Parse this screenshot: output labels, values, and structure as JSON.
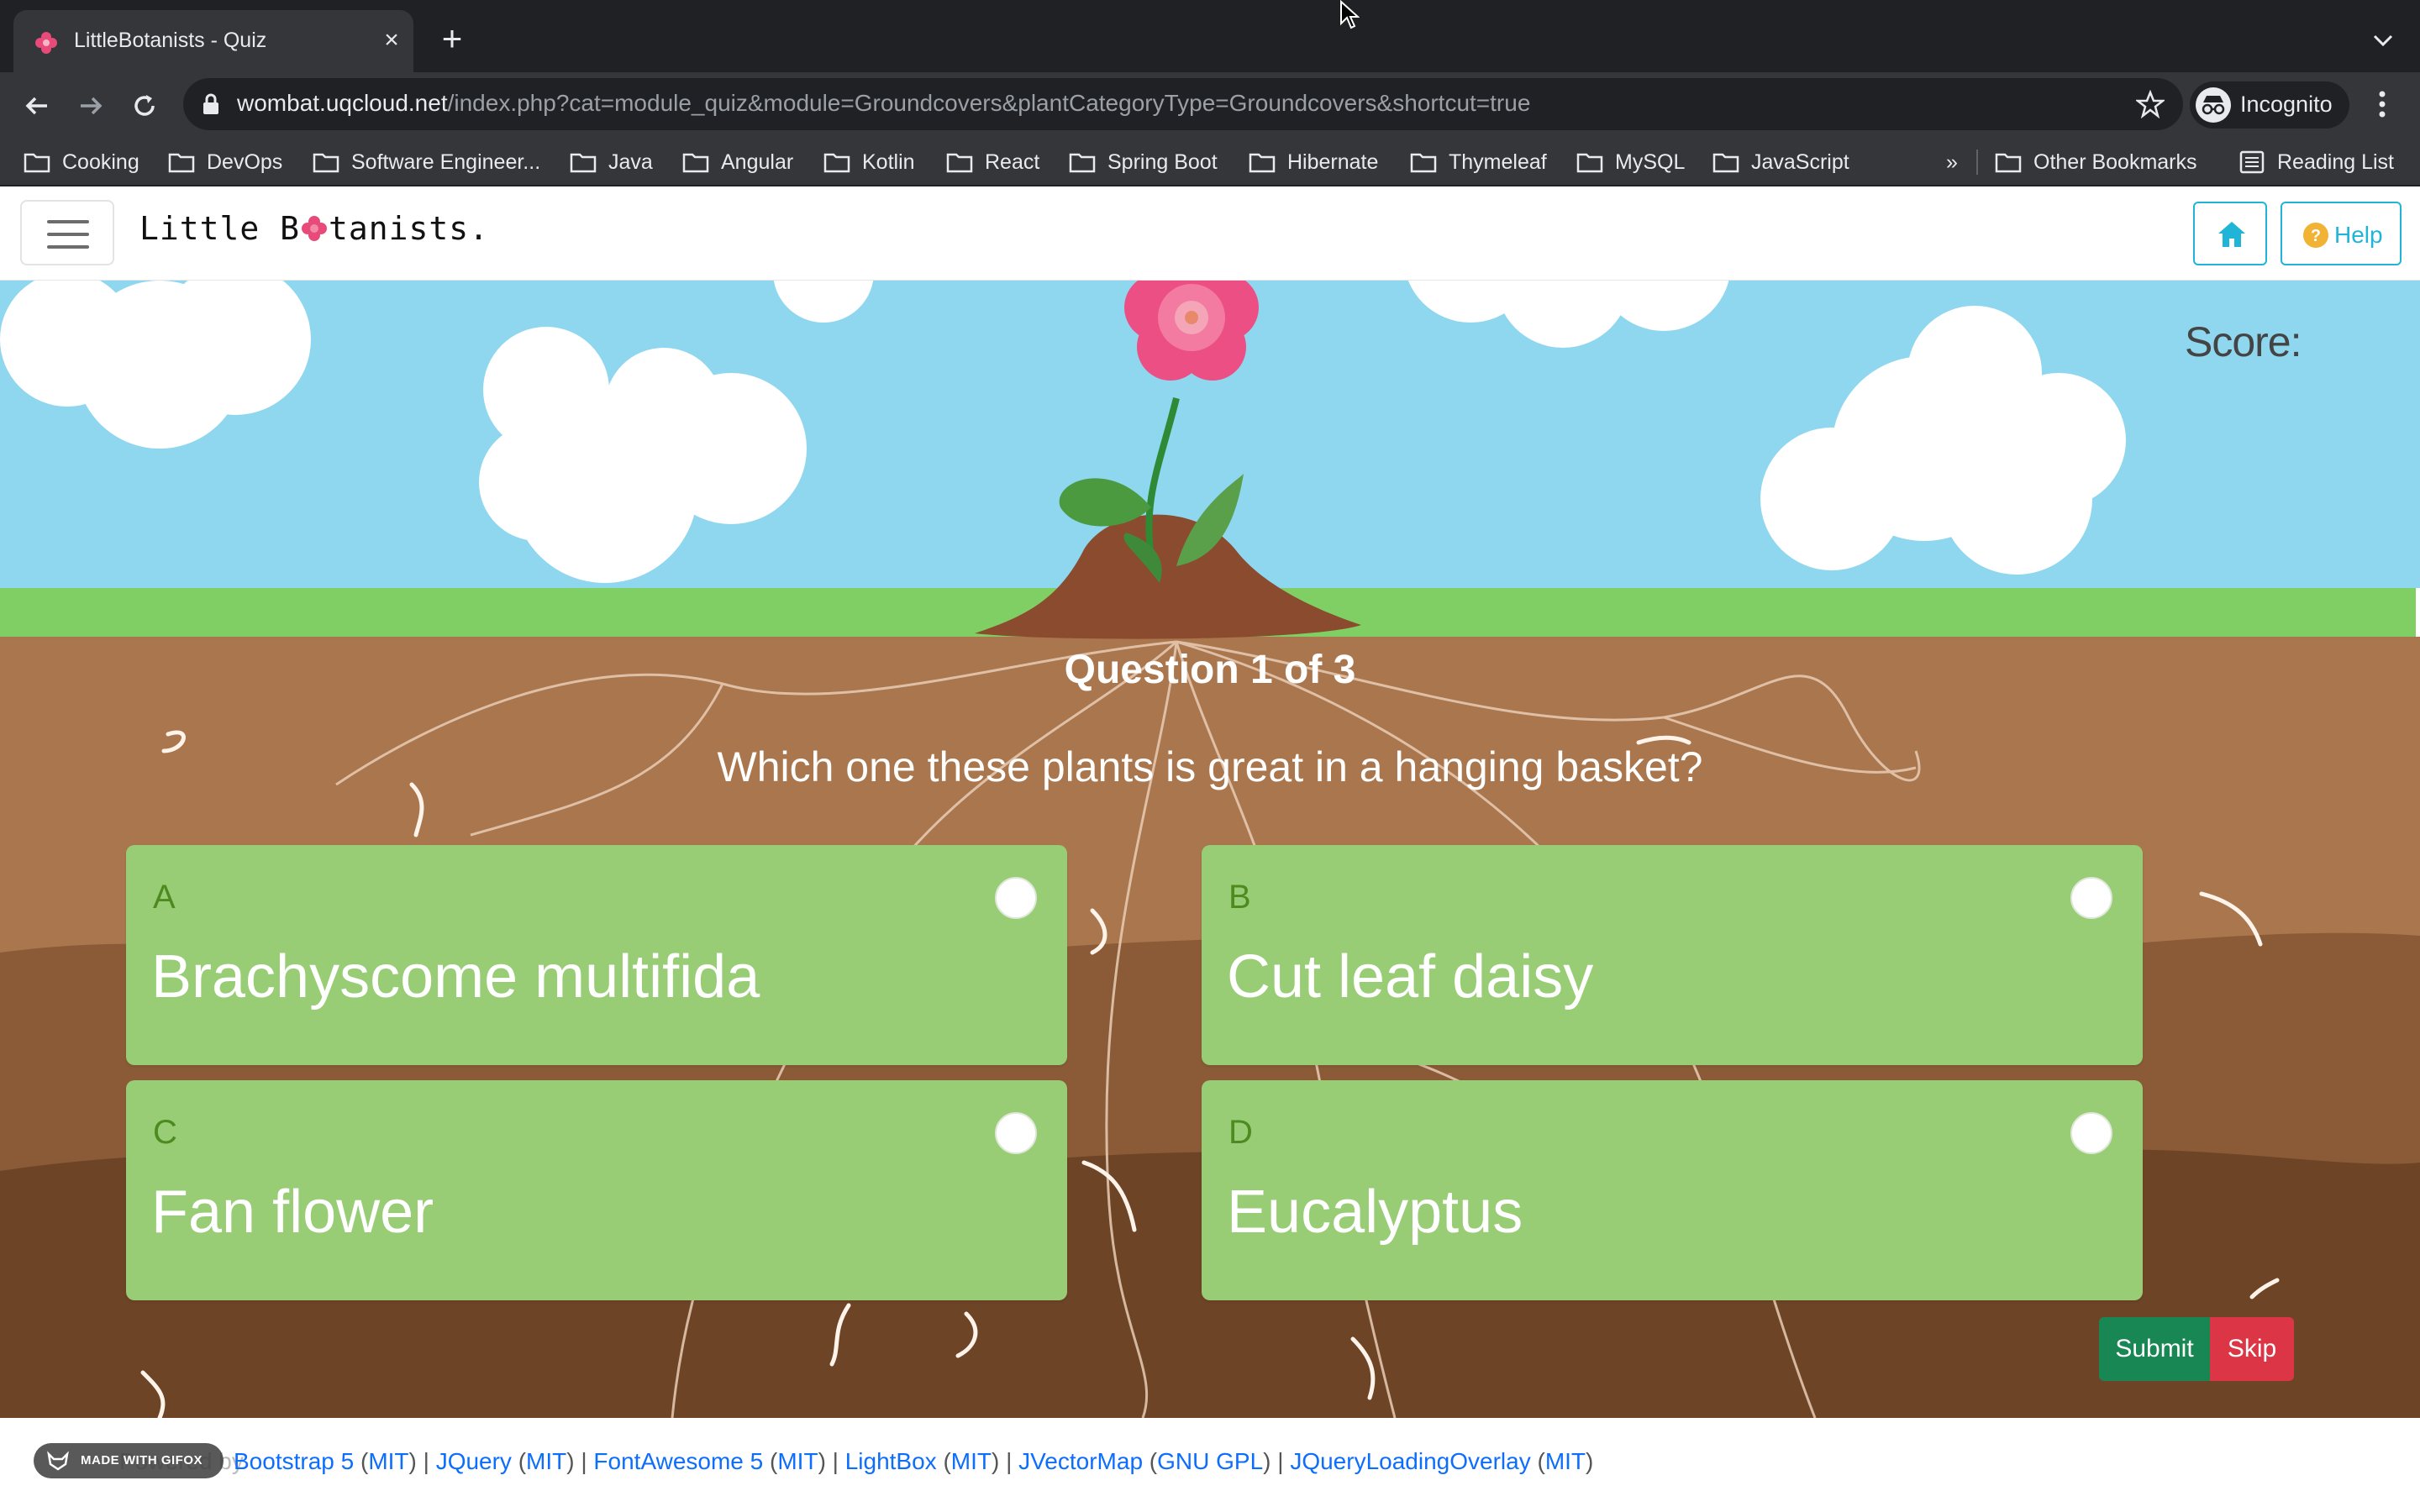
{
  "browser": {
    "tab_title": "LittleBotanists - Quiz",
    "url_host": "wombat.uqcloud.net",
    "url_path": "/index.php?cat=module_quiz&module=Groundcovers&plantCategoryType=Groundcovers&shortcut=true",
    "incognito_label": "Incognito",
    "bookmarks": [
      "Cooking",
      "DevOps",
      "Software Engineer...",
      "Java",
      "Angular",
      "Kotlin",
      "React",
      "Spring Boot",
      "Hibernate",
      "Thymeleaf",
      "MySQL",
      "JavaScript"
    ],
    "overflow_label": "»",
    "other_bookmarks": "Other Bookmarks",
    "reading_list": "Reading List"
  },
  "header": {
    "brand_before": "Little B",
    "brand_after": "tanists.",
    "help_label": "Help"
  },
  "quiz": {
    "score_label": "Score:",
    "question_counter": "Question 1 of 3",
    "question": "Which one these plants is great in a hanging basket?",
    "options": [
      {
        "letter": "A",
        "text": "Brachyscome multifida"
      },
      {
        "letter": "B",
        "text": "Cut leaf daisy"
      },
      {
        "letter": "C",
        "text": "Fan flower"
      },
      {
        "letter": "D",
        "text": "Eucalyptus"
      }
    ],
    "submit_label": "Submit",
    "skip_label": "Skip"
  },
  "footer": {
    "prefix": "Powered by",
    "credits": [
      {
        "name": "Bootstrap 5",
        "license": "MIT"
      },
      {
        "name": "JQuery",
        "license": "MIT"
      },
      {
        "name": "FontAwesome 5",
        "license": "MIT"
      },
      {
        "name": "LightBox",
        "license": "MIT"
      },
      {
        "name": "JVectorMap",
        "license": "GNU GPL"
      },
      {
        "name": "JQueryLoadingOverlay",
        "license": "MIT"
      }
    ],
    "badge": "MADE WITH GIFOX"
  },
  "colors": {
    "sky": "#8fd6ef",
    "grass": "#7fcf64",
    "soil": "#a9764d",
    "option_bg": "#98cd76",
    "submit": "#198754",
    "skip": "#dc3545",
    "accent": "#20b5d6"
  }
}
